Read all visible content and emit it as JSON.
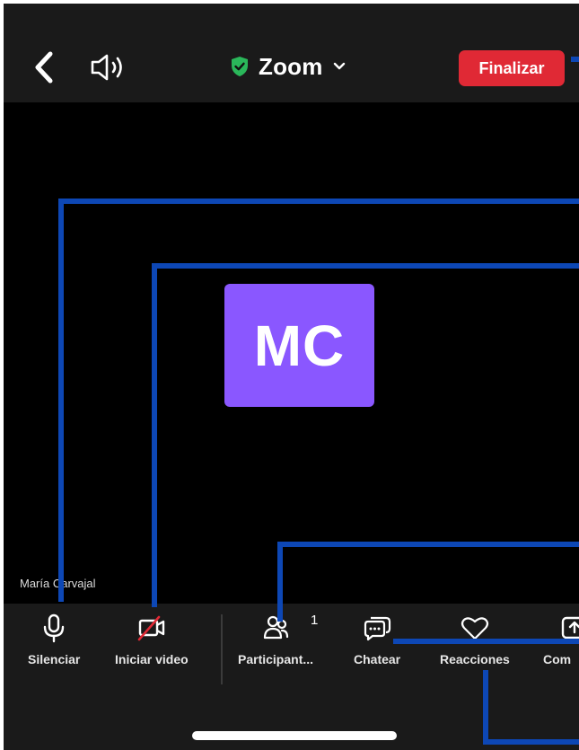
{
  "header": {
    "title": "Zoom",
    "end_label": "Finalizar",
    "icons": {
      "back": "chevron-left-icon",
      "speaker": "speaker-icon",
      "shield": "shield-check-icon",
      "dropdown": "chevron-down-icon"
    },
    "shield_color": "#2ab75a",
    "end_color": "#e02935"
  },
  "video": {
    "initials": "MC",
    "participant_name": "María Carvajal",
    "avatar_color": "#8a57ff"
  },
  "toolbar": {
    "items": [
      {
        "label": "Silenciar",
        "icon": "microphone-icon"
      },
      {
        "label": "Iniciar video",
        "icon": "video-off-icon"
      },
      {
        "label": "Participant...",
        "icon": "participants-icon"
      },
      {
        "label": "Chatear",
        "icon": "chat-icon"
      },
      {
        "label": "Reacciones",
        "icon": "heart-icon"
      },
      {
        "label": "Com",
        "icon": "share-icon"
      }
    ],
    "participant_count": "1"
  },
  "callout_color": "#0d47b5"
}
